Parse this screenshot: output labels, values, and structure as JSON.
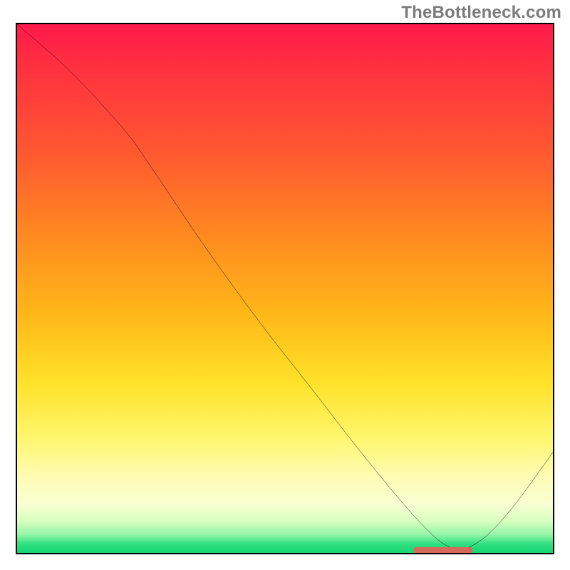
{
  "watermark": {
    "text": "TheBottleneck.com"
  },
  "colors": {
    "border": "#000000",
    "line": "#000000",
    "marker": "#d66a5a",
    "watermark": "#7b7b7b"
  },
  "chart_data": {
    "type": "line",
    "title": "",
    "xlabel": "",
    "ylabel": "",
    "xlim": [
      0,
      1
    ],
    "ylim": [
      0,
      1
    ],
    "grid": false,
    "legend": false,
    "x": [
      0.0,
      0.1,
      0.2,
      0.25,
      0.35,
      0.45,
      0.55,
      0.65,
      0.75,
      0.81,
      0.86,
      0.92,
      1.0
    ],
    "y": [
      1.0,
      0.91,
      0.8,
      0.73,
      0.58,
      0.44,
      0.31,
      0.18,
      0.06,
      0.01,
      0.02,
      0.08,
      0.19
    ],
    "marker": {
      "shape": "pill",
      "x_center": 0.795,
      "y_center": 0.005,
      "width": 0.11,
      "height": 0.012
    }
  }
}
